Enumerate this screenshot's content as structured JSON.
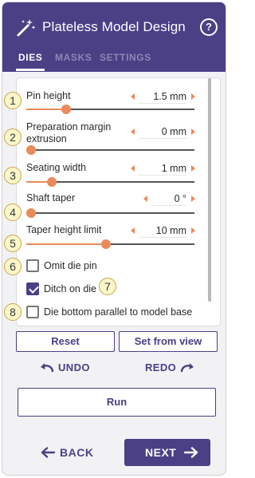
{
  "app": {
    "title": "Plateless Model Design",
    "wand_icon": "magic-wand-icon",
    "help_icon": "?"
  },
  "tabs": [
    {
      "label": "DIES",
      "active": true
    },
    {
      "label": "MASKS",
      "active": false
    },
    {
      "label": "SETTINGS",
      "active": false
    }
  ],
  "params": [
    {
      "label": "Pin height",
      "value": "1.5 mm",
      "level": 0.22
    },
    {
      "label": "Preparation margin extrusion",
      "value": "0 mm",
      "level": 0.0
    },
    {
      "label": "Seating width",
      "value": "1 mm",
      "level": 0.13
    },
    {
      "label": "Shaft taper",
      "value": "0 °",
      "level": 0.0
    },
    {
      "label": "Taper height limit",
      "value": "10 mm",
      "level": 0.47
    }
  ],
  "checkboxes": [
    {
      "label": "Omit die pin",
      "checked": false
    },
    {
      "label": "Ditch on die",
      "checked": true
    },
    {
      "label": "Die bottom parallel to model base",
      "checked": false
    }
  ],
  "badges": [
    "1",
    "2",
    "3",
    "4",
    "5",
    "6",
    "7",
    "8"
  ],
  "actions": {
    "reset": "Reset",
    "set_from_view": "Set from view",
    "undo": "UNDO",
    "redo": "REDO",
    "run": "Run",
    "back": "BACK",
    "next": "NEXT"
  },
  "colors": {
    "accent": "#4b3f86",
    "slider": "#ea8a5a",
    "badge_bg": "#fbf6c9"
  }
}
